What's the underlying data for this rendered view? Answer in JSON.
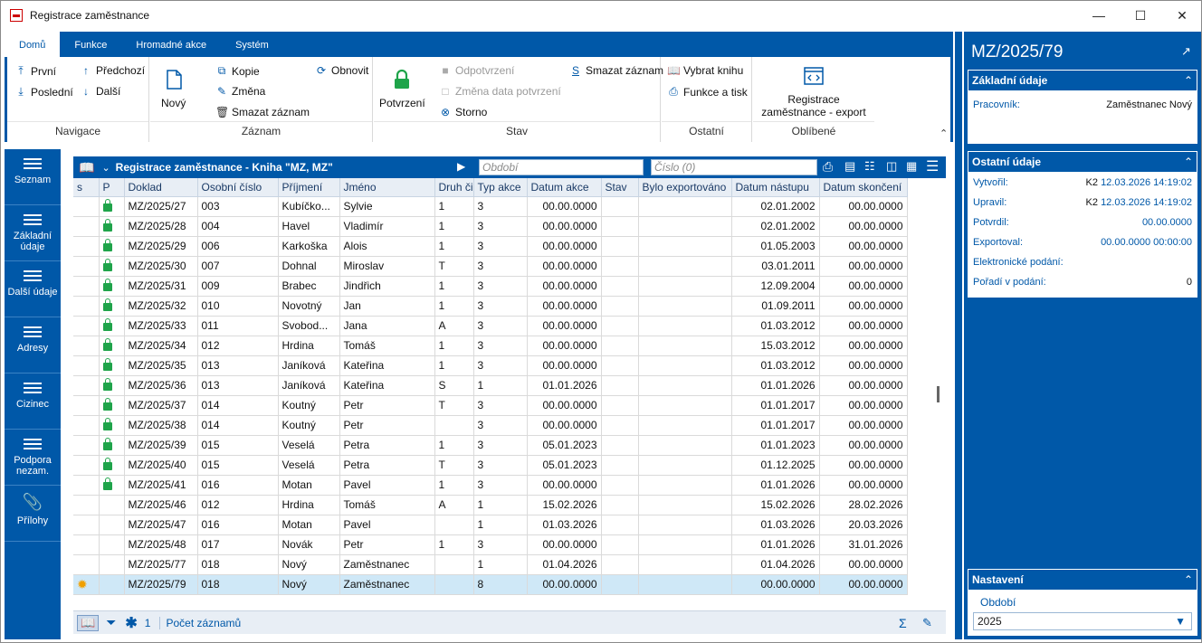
{
  "window": {
    "title": "Registrace zaměstnance"
  },
  "ribbon": {
    "tabs": [
      "Domů",
      "Funkce",
      "Hromadné akce",
      "Systém"
    ],
    "navigation": {
      "first": "První",
      "previous": "Předchozí",
      "last": "Poslední",
      "next": "Další",
      "label": "Navigace"
    },
    "record": {
      "new": "Nový",
      "copy": "Kopie",
      "change": "Změna",
      "delete": "Smazat záznam",
      "refresh": "Obnovit",
      "label": "Záznam"
    },
    "state": {
      "confirm": "Potvrzení",
      "unconfirm": "Odpotvrzení",
      "change_date": "Změna data potvrzení",
      "cancel": "Storno",
      "delete_record": "Smazat záznam",
      "label": "Stav"
    },
    "other": {
      "select_book": "Vybrat knihu",
      "functions_print": "Funkce a tisk",
      "label": "Ostatní"
    },
    "favorites": {
      "export": "Registrace zaměstnance - export",
      "label": "Oblíbené"
    }
  },
  "leftnav": [
    {
      "label": "Seznam"
    },
    {
      "label": "Základní údaje"
    },
    {
      "label": "Další údaje"
    },
    {
      "label": "Adresy"
    },
    {
      "label": "Cizinec"
    },
    {
      "label": "Podpora nezam."
    },
    {
      "label": "Přílohy"
    }
  ],
  "grid": {
    "title": "Registrace zaměstnance - Kniha \"MZ, MZ\"",
    "period_placeholder": "Období",
    "number_placeholder": "Číslo (0)",
    "columns": [
      "s",
      "P",
      "Doklad",
      "Osobní číslo",
      "Příjmení",
      "Jméno",
      "Druh či",
      "Typ akce",
      "Datum akce",
      "Stav",
      "Bylo exportováno",
      "Datum nástupu",
      "Datum skončení"
    ],
    "rows": [
      {
        "lock": true,
        "doklad": "MZ/2025/27",
        "os": "003",
        "prijmeni": "Kubíčko...",
        "jmeno": "Sylvie",
        "druh": "1",
        "typ": "3",
        "datum_akce": "00.00.0000",
        "nastup": "02.01.2002",
        "skonceni": "00.00.0000"
      },
      {
        "lock": true,
        "doklad": "MZ/2025/28",
        "os": "004",
        "prijmeni": "Havel",
        "jmeno": "Vladimír",
        "druh": "1",
        "typ": "3",
        "datum_akce": "00.00.0000",
        "nastup": "02.01.2002",
        "skonceni": "00.00.0000"
      },
      {
        "lock": true,
        "doklad": "MZ/2025/29",
        "os": "006",
        "prijmeni": "Karkoška",
        "jmeno": "Alois",
        "druh": "1",
        "typ": "3",
        "datum_akce": "00.00.0000",
        "nastup": "01.05.2003",
        "skonceni": "00.00.0000"
      },
      {
        "lock": true,
        "doklad": "MZ/2025/30",
        "os": "007",
        "prijmeni": "Dohnal",
        "jmeno": "Miroslav",
        "druh": "T",
        "typ": "3",
        "datum_akce": "00.00.0000",
        "nastup": "03.01.2011",
        "skonceni": "00.00.0000"
      },
      {
        "lock": true,
        "doklad": "MZ/2025/31",
        "os": "009",
        "prijmeni": "Brabec",
        "jmeno": "Jindřich",
        "druh": "1",
        "typ": "3",
        "datum_akce": "00.00.0000",
        "nastup": "12.09.2004",
        "skonceni": "00.00.0000"
      },
      {
        "lock": true,
        "doklad": "MZ/2025/32",
        "os": "010",
        "prijmeni": "Novotný",
        "jmeno": "Jan",
        "druh": "1",
        "typ": "3",
        "datum_akce": "00.00.0000",
        "nastup": "01.09.2011",
        "skonceni": "00.00.0000"
      },
      {
        "lock": true,
        "doklad": "MZ/2025/33",
        "os": "011",
        "prijmeni": "Svobod...",
        "jmeno": "Jana",
        "druh": "A",
        "typ": "3",
        "datum_akce": "00.00.0000",
        "nastup": "01.03.2012",
        "skonceni": "00.00.0000"
      },
      {
        "lock": true,
        "doklad": "MZ/2025/34",
        "os": "012",
        "prijmeni": "Hrdina",
        "jmeno": "Tomáš",
        "druh": "1",
        "typ": "3",
        "datum_akce": "00.00.0000",
        "nastup": "15.03.2012",
        "skonceni": "00.00.0000"
      },
      {
        "lock": true,
        "doklad": "MZ/2025/35",
        "os": "013",
        "prijmeni": "Janíková",
        "jmeno": "Kateřina",
        "druh": "1",
        "typ": "3",
        "datum_akce": "00.00.0000",
        "nastup": "01.03.2012",
        "skonceni": "00.00.0000"
      },
      {
        "lock": true,
        "doklad": "MZ/2025/36",
        "os": "013",
        "prijmeni": "Janíková",
        "jmeno": "Kateřina",
        "druh": "S",
        "typ": "1",
        "datum_akce": "01.01.2026",
        "nastup": "01.01.2026",
        "skonceni": "00.00.0000"
      },
      {
        "lock": true,
        "doklad": "MZ/2025/37",
        "os": "014",
        "prijmeni": "Koutný",
        "jmeno": "Petr",
        "druh": "T",
        "typ": "3",
        "datum_akce": "00.00.0000",
        "nastup": "01.01.2017",
        "skonceni": "00.00.0000"
      },
      {
        "lock": true,
        "doklad": "MZ/2025/38",
        "os": "014",
        "prijmeni": "Koutný",
        "jmeno": "Petr",
        "druh": "",
        "typ": "3",
        "datum_akce": "00.00.0000",
        "nastup": "01.01.2017",
        "skonceni": "00.00.0000"
      },
      {
        "lock": true,
        "doklad": "MZ/2025/39",
        "os": "015",
        "prijmeni": "Veselá",
        "jmeno": "Petra",
        "druh": "1",
        "typ": "3",
        "datum_akce": "05.01.2023",
        "nastup": "01.01.2023",
        "skonceni": "00.00.0000"
      },
      {
        "lock": true,
        "doklad": "MZ/2025/40",
        "os": "015",
        "prijmeni": "Veselá",
        "jmeno": "Petra",
        "druh": "T",
        "typ": "3",
        "datum_akce": "05.01.2023",
        "nastup": "01.12.2025",
        "skonceni": "00.00.0000"
      },
      {
        "lock": true,
        "doklad": "MZ/2025/41",
        "os": "016",
        "prijmeni": "Motan",
        "jmeno": "Pavel",
        "druh": "1",
        "typ": "3",
        "datum_akce": "00.00.0000",
        "nastup": "01.01.2026",
        "skonceni": "00.00.0000"
      },
      {
        "lock": false,
        "doklad": "MZ/2025/46",
        "os": "012",
        "prijmeni": "Hrdina",
        "jmeno": "Tomáš",
        "druh": "A",
        "typ": "1",
        "datum_akce": "15.02.2026",
        "nastup": "15.02.2026",
        "skonceni": "28.02.2026"
      },
      {
        "lock": false,
        "doklad": "MZ/2025/47",
        "os": "016",
        "prijmeni": "Motan",
        "jmeno": "Pavel",
        "druh": "",
        "typ": "1",
        "datum_akce": "01.03.2026",
        "nastup": "01.03.2026",
        "skonceni": "20.03.2026"
      },
      {
        "lock": false,
        "doklad": "MZ/2025/48",
        "os": "017",
        "prijmeni": "Novák",
        "jmeno": "Petr",
        "druh": "1",
        "typ": "3",
        "datum_akce": "00.00.0000",
        "nastup": "01.01.2026",
        "skonceni": "31.01.2026"
      },
      {
        "lock": false,
        "doklad": "MZ/2025/77",
        "os": "018",
        "prijmeni": "Nový",
        "jmeno": "Zaměstnanec",
        "druh": "",
        "typ": "1",
        "datum_akce": "01.04.2026",
        "nastup": "01.04.2026",
        "skonceni": "00.00.0000"
      },
      {
        "lock": false,
        "star": true,
        "selected": true,
        "doklad": "MZ/2025/79",
        "os": "018",
        "prijmeni": "Nový",
        "jmeno": "Zaměstnanec",
        "druh": "",
        "typ": "8",
        "datum_akce": "00.00.0000",
        "nastup": "00.00.0000",
        "skonceni": "00.00.0000"
      }
    ],
    "footer": {
      "count": "1",
      "records_label": "Počet záznamů"
    }
  },
  "rpanel": {
    "title": "MZ/2025/79",
    "basic": {
      "head": "Základní údaje",
      "worker_label": "Pracovník:",
      "worker_value": "Zaměstnanec Nový"
    },
    "other": {
      "head": "Ostatní údaje",
      "created_label": "Vytvořil:",
      "created_user": "K2",
      "created_date": "12.03.2026 14:19:02",
      "modified_label": "Upravil:",
      "modified_user": "K2",
      "modified_date": "12.03.2026 14:19:02",
      "confirmed_label": "Potvrdil:",
      "confirmed_date": "00.00.0000",
      "exported_label": "Exportoval:",
      "exported_date": "00.00.0000 00:00:00",
      "efiling_label": "Elektronické podání:",
      "order_label": "Pořadí v podání:",
      "order_value": "0"
    },
    "settings": {
      "head": "Nastavení",
      "period_label": "Období",
      "period_value": "2025"
    }
  }
}
